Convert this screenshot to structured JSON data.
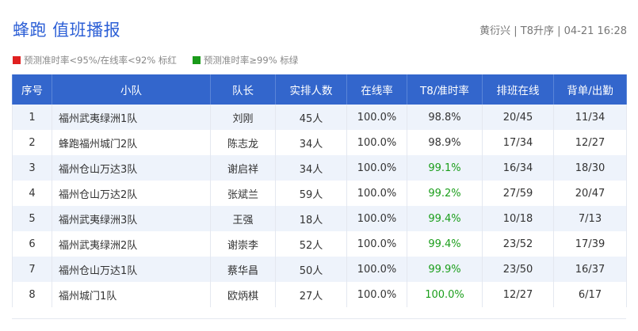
{
  "header": {
    "title": "蜂跑 值班播报",
    "meta": "黄衍兴 | T8升序 | 04-21 16:28"
  },
  "legend": [
    {
      "text": "预测准时率<95%/在线率<92% 标红",
      "color": "#e02020"
    },
    {
      "text": "预测准时率≥99% 标绿",
      "color": "#1a9a1a"
    }
  ],
  "colors": {
    "header_bg": "#3366cc",
    "title": "#2c5fd6",
    "green_value": "#1b9e1b",
    "row_alt": "#eef3fb"
  },
  "table": {
    "columns": [
      "序号",
      "小队",
      "队长",
      "实排人数",
      "在线率",
      "T8/准时率",
      "排班在线",
      "背单/出勤"
    ],
    "rows": [
      {
        "no": "1",
        "team": "福州武夷绿洲1队",
        "leader": "刘刚",
        "scheduled": "45人",
        "online": "100.0%",
        "t8": "98.8%",
        "t8_highlight": "none",
        "shift": "20/45",
        "attendance": "11/34"
      },
      {
        "no": "2",
        "team": "蜂跑福州城门2队",
        "leader": "陈志龙",
        "scheduled": "34人",
        "online": "100.0%",
        "t8": "98.9%",
        "t8_highlight": "none",
        "shift": "17/34",
        "attendance": "12/27"
      },
      {
        "no": "3",
        "team": "福州仓山万达3队",
        "leader": "谢启祥",
        "scheduled": "34人",
        "online": "100.0%",
        "t8": "99.1%",
        "t8_highlight": "green",
        "shift": "16/34",
        "attendance": "18/30"
      },
      {
        "no": "4",
        "team": "福州仓山万达2队",
        "leader": "张斌兰",
        "scheduled": "59人",
        "online": "100.0%",
        "t8": "99.2%",
        "t8_highlight": "green",
        "shift": "27/59",
        "attendance": "20/47"
      },
      {
        "no": "5",
        "team": "福州武夷绿洲3队",
        "leader": "王强",
        "scheduled": "18人",
        "online": "100.0%",
        "t8": "99.4%",
        "t8_highlight": "green",
        "shift": "10/18",
        "attendance": "7/13"
      },
      {
        "no": "6",
        "team": "福州武夷绿洲2队",
        "leader": "谢崇李",
        "scheduled": "52人",
        "online": "100.0%",
        "t8": "99.4%",
        "t8_highlight": "green",
        "shift": "23/52",
        "attendance": "17/39"
      },
      {
        "no": "7",
        "team": "福州仓山万达1队",
        "leader": "蔡华昌",
        "scheduled": "50人",
        "online": "100.0%",
        "t8": "99.9%",
        "t8_highlight": "green",
        "shift": "23/50",
        "attendance": "16/37"
      },
      {
        "no": "8",
        "team": "福州城门1队",
        "leader": "欧炳棋",
        "scheduled": "27人",
        "online": "100.0%",
        "t8": "100.0%",
        "t8_highlight": "green",
        "shift": "12/27",
        "attendance": "6/17"
      }
    ]
  }
}
